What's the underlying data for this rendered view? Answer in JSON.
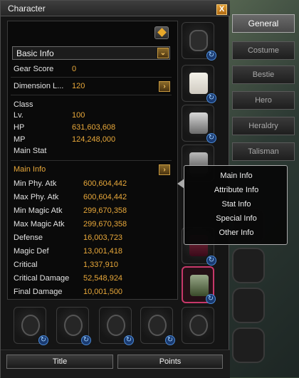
{
  "window": {
    "title": "Character",
    "close_label": "X"
  },
  "basic_info": {
    "dropdown_label": "Basic Info",
    "gear_score_label": "Gear Score",
    "gear_score_value": "0",
    "dimension_label": "Dimension L...",
    "dimension_value": "120",
    "class_label": "Class",
    "lv_label": "Lv.",
    "lv_value": "100",
    "hp_label": "HP",
    "hp_value": "631,603,608",
    "mp_label": "MP",
    "mp_value": "124,248,000",
    "main_stat_label": "Main Stat"
  },
  "main_info": {
    "label": "Main Info",
    "stats": [
      {
        "label": "Min Phy. Atk",
        "value": "600,604,442"
      },
      {
        "label": "Max Phy. Atk",
        "value": "600,604,442"
      },
      {
        "label": "Min Magic Atk",
        "value": "299,670,358"
      },
      {
        "label": "Max Magic Atk",
        "value": "299,670,358"
      },
      {
        "label": "Defense",
        "value": "16,003,723"
      },
      {
        "label": "Magic Def",
        "value": "13,001,418"
      },
      {
        "label": "Critical",
        "value": "1,337,910"
      },
      {
        "label": "Critical Damage",
        "value": "52,548,924"
      },
      {
        "label": "Final Damage",
        "value": "10,001,500"
      }
    ]
  },
  "tabs": [
    "General",
    "Costume",
    "Bestie",
    "Hero",
    "Heraldry",
    "Talisman"
  ],
  "popup": [
    "Main Info",
    "Attribute Info",
    "Stat Info",
    "Special Info",
    "Other Info"
  ],
  "bottom_buttons": {
    "title": "Title",
    "points": "Points"
  },
  "colors": {
    "accent": "#e8a83a",
    "refresh": "#4a8ad8"
  }
}
